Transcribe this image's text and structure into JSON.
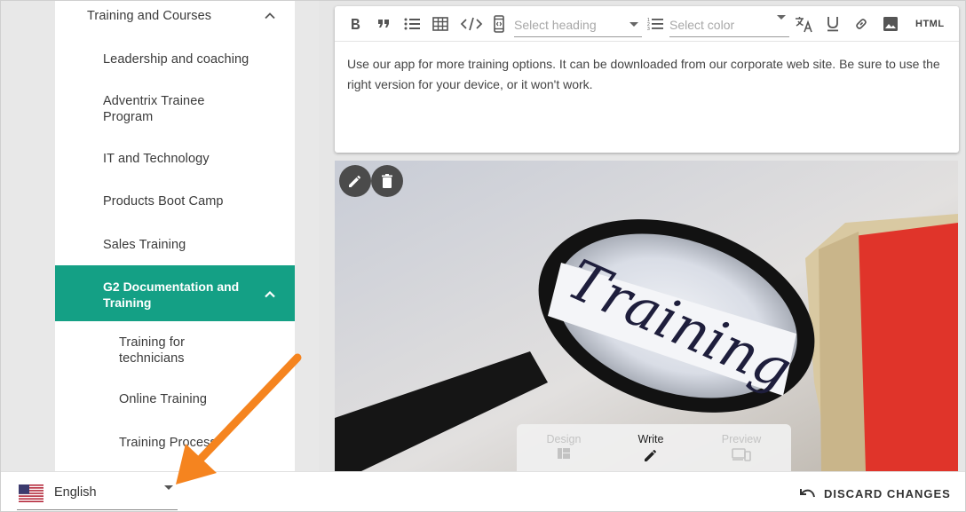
{
  "sidebar": {
    "items": [
      {
        "label": "Training and Courses"
      },
      {
        "label": "Leadership and coaching"
      },
      {
        "label": "Adventrix Trainee Program"
      },
      {
        "label": "IT and Technology"
      },
      {
        "label": "Products Boot Camp"
      },
      {
        "label": "Sales Training"
      },
      {
        "label": "G2 Documentation and Training"
      },
      {
        "label": "Training for technicians"
      },
      {
        "label": "Online Training"
      },
      {
        "label": "Training Process"
      }
    ]
  },
  "toolbar": {
    "heading_placeholder": "Select heading",
    "color_placeholder": "Select color",
    "html_label": "HTML"
  },
  "editor": {
    "body": "Use our app for more training options. It can be downloaded from our corporate web site. Be sure to use the right version for your device, or it won't work."
  },
  "image": {
    "word": "Training"
  },
  "modes": {
    "design": "Design",
    "write": "Write",
    "preview": "Preview"
  },
  "language": {
    "selected": "English"
  },
  "actions": {
    "discard": "DISCARD CHANGES"
  },
  "colors": {
    "accent": "#14a085",
    "annotation_arrow": "#f5841f",
    "book_red": "#e0342a"
  }
}
